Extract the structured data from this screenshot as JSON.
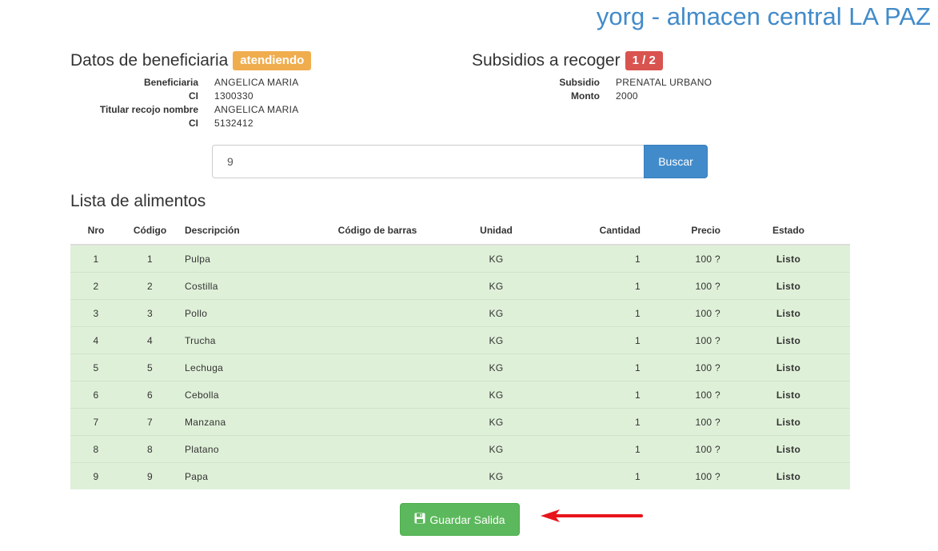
{
  "header": {
    "title": "yorg - almacen central LA PAZ"
  },
  "beneficiary": {
    "title": "Datos de beneficiaria",
    "status_badge": "atendiendo",
    "fields": [
      {
        "term": "Beneficiaria",
        "value": "ANGELICA MARIA"
      },
      {
        "term": "CI",
        "value": "1300330"
      },
      {
        "term": "Titular recojo nombre",
        "value": "ANGELICA MARIA"
      },
      {
        "term": "CI",
        "value": "5132412"
      }
    ]
  },
  "subsidies": {
    "title": "Subsidios a recoger",
    "count_badge": "1 / 2",
    "fields": [
      {
        "term": "Subsidio",
        "value": "PRENATAL URBANO"
      },
      {
        "term": "Monto",
        "value": "2000"
      }
    ]
  },
  "search": {
    "value": "9",
    "button_label": "Buscar"
  },
  "food_list": {
    "title": "Lista de alimentos",
    "columns": [
      "Nro",
      "Código",
      "Descripción",
      "Código de barras",
      "Unidad",
      "Cantidad",
      "Precio",
      "Estado"
    ],
    "rows": [
      {
        "nro": "1",
        "codigo": "1",
        "descripcion": "Pulpa",
        "barras": "",
        "unidad": "KG",
        "cantidad": "1",
        "precio": "100 ?",
        "estado": "Listo"
      },
      {
        "nro": "2",
        "codigo": "2",
        "descripcion": "Costilla",
        "barras": "",
        "unidad": "KG",
        "cantidad": "1",
        "precio": "100 ?",
        "estado": "Listo"
      },
      {
        "nro": "3",
        "codigo": "3",
        "descripcion": "Pollo",
        "barras": "",
        "unidad": "KG",
        "cantidad": "1",
        "precio": "100 ?",
        "estado": "Listo"
      },
      {
        "nro": "4",
        "codigo": "4",
        "descripcion": "Trucha",
        "barras": "",
        "unidad": "KG",
        "cantidad": "1",
        "precio": "100 ?",
        "estado": "Listo"
      },
      {
        "nro": "5",
        "codigo": "5",
        "descripcion": "Lechuga",
        "barras": "",
        "unidad": "KG",
        "cantidad": "1",
        "precio": "100 ?",
        "estado": "Listo"
      },
      {
        "nro": "6",
        "codigo": "6",
        "descripcion": "Cebolla",
        "barras": "",
        "unidad": "KG",
        "cantidad": "1",
        "precio": "100 ?",
        "estado": "Listo"
      },
      {
        "nro": "7",
        "codigo": "7",
        "descripcion": "Manzana",
        "barras": "",
        "unidad": "KG",
        "cantidad": "1",
        "precio": "100 ?",
        "estado": "Listo"
      },
      {
        "nro": "8",
        "codigo": "8",
        "descripcion": "Platano",
        "barras": "",
        "unidad": "KG",
        "cantidad": "1",
        "precio": "100 ?",
        "estado": "Listo"
      },
      {
        "nro": "9",
        "codigo": "9",
        "descripcion": "Papa",
        "barras": "",
        "unidad": "KG",
        "cantidad": "1",
        "precio": "100 ?",
        "estado": "Listo"
      }
    ]
  },
  "actions": {
    "save_label": "Guardar Salida",
    "save_icon": "floppy-disk-icon"
  },
  "colors": {
    "brand_blue": "#428bca",
    "warning": "#f0ad4e",
    "danger": "#d9534f",
    "success": "#5cb85c",
    "row_success": "#dff0d8",
    "annotation_arrow": "#e8141c"
  }
}
